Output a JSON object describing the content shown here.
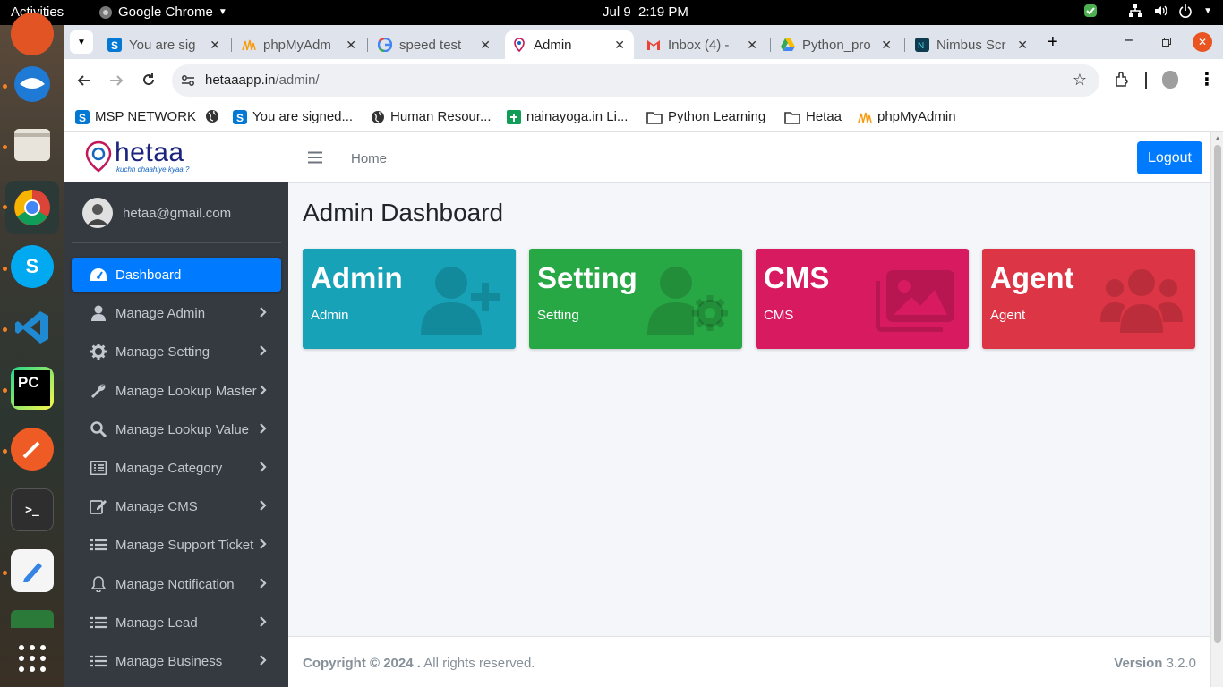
{
  "system": {
    "activities": "Activities",
    "app_name": "Google Chrome",
    "date": "Jul 9",
    "time": "2:19 PM"
  },
  "tabs": [
    {
      "title": "You are sig",
      "icon": "skype-s-icon"
    },
    {
      "title": "phpMyAdm",
      "icon": "phpmyadmin-icon"
    },
    {
      "title": "speed test",
      "icon": "google-icon"
    },
    {
      "title": "Admin",
      "icon": "hetaa-icon",
      "active": true
    },
    {
      "title": "Inbox (4) -",
      "icon": "gmail-icon"
    },
    {
      "title": "Python_pro",
      "icon": "drive-icon"
    },
    {
      "title": "Nimbus Scr",
      "icon": "nimbus-icon"
    }
  ],
  "url": {
    "host": "hetaaapp.in",
    "path": "/admin/"
  },
  "bookmarks": [
    {
      "label": "MSP NETWORK",
      "icon": "skype-s-icon"
    },
    {
      "label": "",
      "icon": "globe-icon"
    },
    {
      "label": "You are signed...",
      "icon": "skype-s-icon"
    },
    {
      "label": "Human Resour...",
      "icon": "globe-icon"
    },
    {
      "label": "nainayoga.in Li...",
      "icon": "sheets-icon"
    },
    {
      "label": "Python Learning",
      "icon": "folder-icon"
    },
    {
      "label": "Hetaa",
      "icon": "folder-icon"
    },
    {
      "label": "phpMyAdmin",
      "icon": "phpmyadmin-icon"
    }
  ],
  "brand": {
    "name": "hetaa",
    "tagline": "kuchh chaahiye kyaa ?"
  },
  "user": {
    "email": "hetaa@gmail.com"
  },
  "nav": [
    {
      "label": "Dashboard",
      "icon": "tachometer-icon",
      "active": true
    },
    {
      "label": "Manage Admin",
      "icon": "user-icon"
    },
    {
      "label": "Manage Setting",
      "icon": "gear-icon"
    },
    {
      "label": "Manage Lookup Master",
      "icon": "wrench-icon"
    },
    {
      "label": "Manage Lookup Value",
      "icon": "search-icon"
    },
    {
      "label": "Manage Category",
      "icon": "list-alt-icon"
    },
    {
      "label": "Manage CMS",
      "icon": "edit-icon"
    },
    {
      "label": "Manage Support Ticket",
      "icon": "list-icon"
    },
    {
      "label": "Manage Notification",
      "icon": "bell-icon"
    },
    {
      "label": "Manage Lead",
      "icon": "list-icon"
    },
    {
      "label": "Manage Business",
      "icon": "list-icon"
    }
  ],
  "header": {
    "home": "Home",
    "logout": "Logout"
  },
  "page_title": "Admin Dashboard",
  "boxes": [
    {
      "heading": "Admin",
      "sub": "Admin",
      "color": "#17a2b8",
      "icon": "user-plus-icon"
    },
    {
      "heading": "Setting",
      "sub": "Setting",
      "color": "#28a745",
      "icon": "user-cog-icon"
    },
    {
      "heading": "CMS",
      "sub": "CMS",
      "color": "#d81b60",
      "icon": "images-icon"
    },
    {
      "heading": "Agent",
      "sub": "Agent",
      "color": "#dc3545",
      "icon": "users-icon"
    }
  ],
  "footer": {
    "copyright": "Copyright © 2024 .",
    "rights": " All rights reserved.",
    "version_label": "Version",
    "version": " 3.2.0"
  },
  "colors": {
    "primary": "#007bff",
    "sidebar_bg": "#343a40",
    "sidebar_text": "#c2c7d0"
  }
}
